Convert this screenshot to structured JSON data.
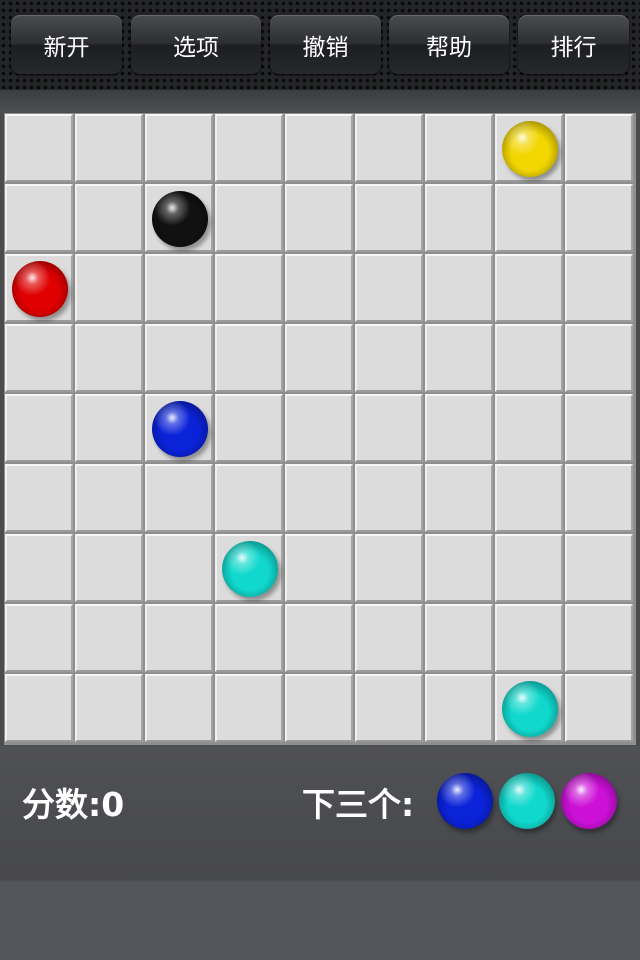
{
  "toolbar": {
    "buttons": [
      {
        "id": "new-game",
        "label": "新开"
      },
      {
        "id": "options",
        "label": "选项"
      },
      {
        "id": "undo",
        "label": "撤销"
      },
      {
        "id": "help",
        "label": "帮助"
      },
      {
        "id": "ranking",
        "label": "排行"
      }
    ]
  },
  "board": {
    "rows": 9,
    "cols": 9,
    "balls": [
      {
        "row": 0,
        "col": 7,
        "color": "yellow"
      },
      {
        "row": 1,
        "col": 2,
        "color": "black"
      },
      {
        "row": 2,
        "col": 0,
        "color": "red"
      },
      {
        "row": 4,
        "col": 2,
        "color": "blue"
      },
      {
        "row": 6,
        "col": 3,
        "color": "cyan"
      },
      {
        "row": 8,
        "col": 7,
        "color": "cyan"
      }
    ]
  },
  "score": {
    "label": "分数:",
    "value": "0"
  },
  "next": {
    "label": "下三个:",
    "balls": [
      "blue",
      "cyan",
      "magenta"
    ]
  },
  "colors": {
    "yellow": "#f2d600",
    "black": "#111111",
    "red": "#e00000",
    "blue": "#0a22d8",
    "cyan": "#10d8cc",
    "magenta": "#cc10d8"
  }
}
